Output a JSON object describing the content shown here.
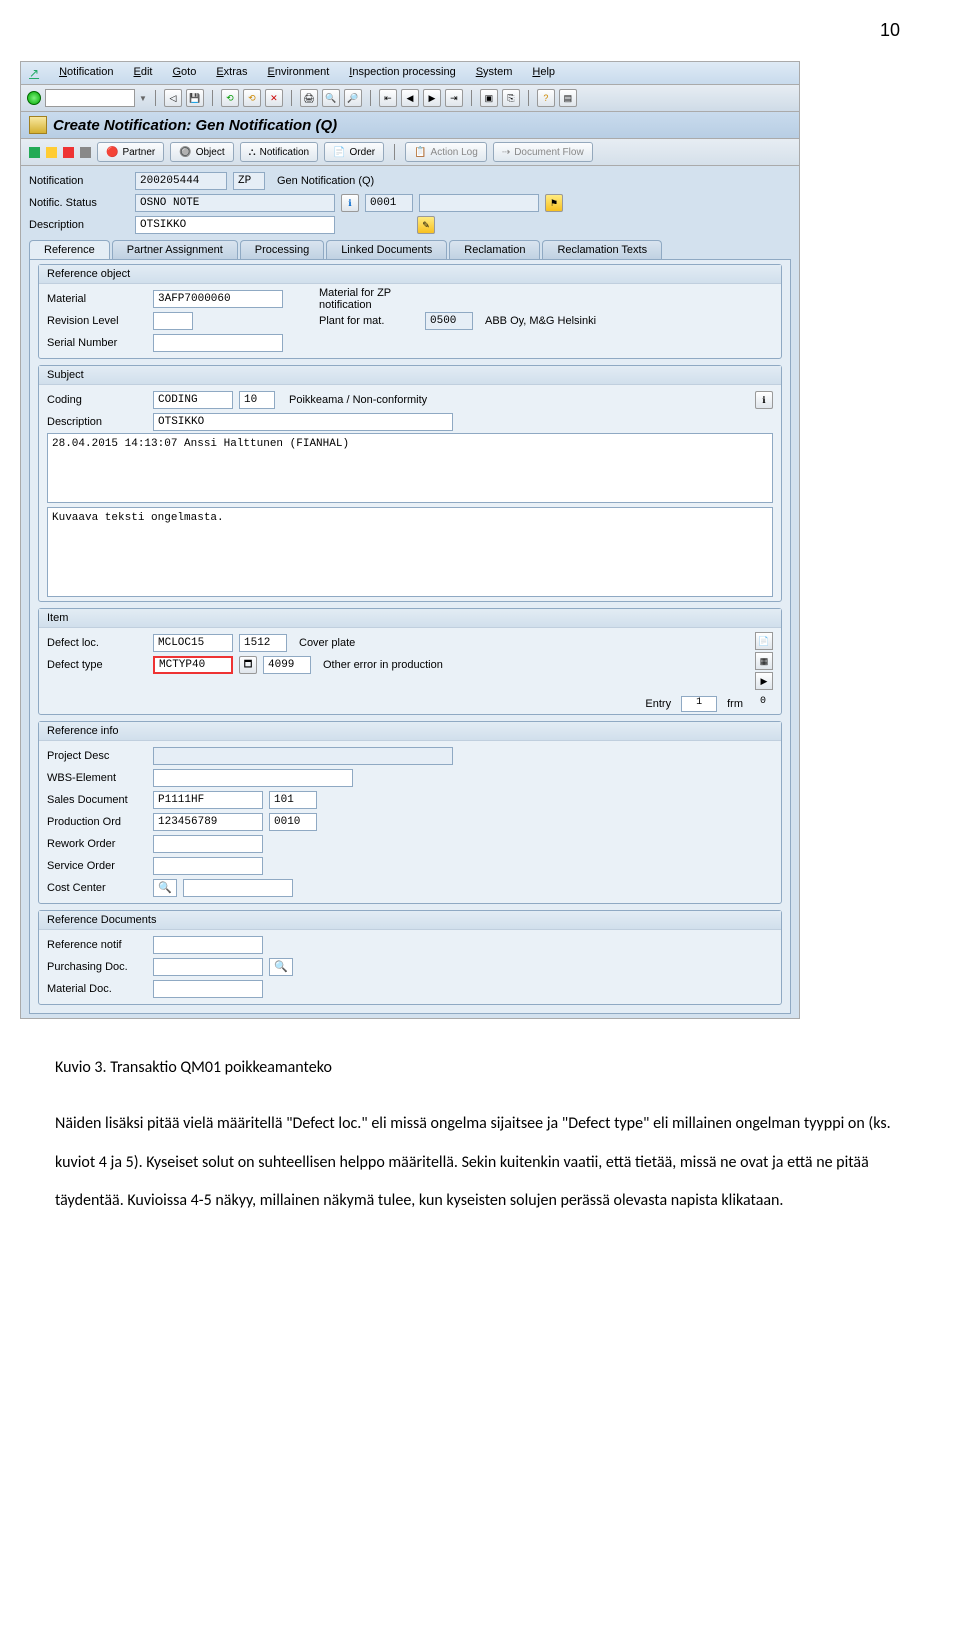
{
  "page_number": "10",
  "menu": [
    "Notification",
    "Edit",
    "Goto",
    "Extras",
    "Environment",
    "Inspection processing",
    "System",
    "Help"
  ],
  "title": "Create Notification: Gen Notification (Q)",
  "appbar": {
    "partner": "Partner",
    "object": "Object",
    "notification": "Notification",
    "order": "Order",
    "actionlog": "Action Log",
    "docflow": "Document Flow"
  },
  "header": {
    "notification_lbl": "Notification",
    "notification_val": "200205444",
    "notification_type": "ZP",
    "notification_desc": "Gen Notification (Q)",
    "status_lbl": "Notific. Status",
    "status_val": "OSNO NOTE",
    "status_code": "0001",
    "description_lbl": "Description",
    "description_val": "OTSIKKO"
  },
  "tabs": [
    "Reference",
    "Partner Assignment",
    "Processing",
    "Linked Documents",
    "Reclamation",
    "Reclamation Texts"
  ],
  "ref_object": {
    "title": "Reference object",
    "material_lbl": "Material",
    "material_val": "3AFP7000060",
    "material_desc": "Material for ZP notification",
    "rev_lbl": "Revision Level",
    "plant_lbl": "Plant for mat.",
    "plant_val": "0500",
    "plant_desc": "ABB Oy, M&G Helsinki",
    "serial_lbl": "Serial Number"
  },
  "subject": {
    "title": "Subject",
    "coding_lbl": "Coding",
    "coding_val": "CODING",
    "coding_num": "10",
    "coding_desc": "Poikkeama / Non-conformity",
    "desc_lbl": "Description",
    "desc_val": "OTSIKKO",
    "log_line": "28.04.2015 14:13:07 Anssi Halttunen (FIANHAL)",
    "text": "Kuvaava teksti ongelmasta."
  },
  "item": {
    "title": "Item",
    "loc_lbl": "Defect loc.",
    "loc_val": "MCLOC15",
    "loc_num": "1512",
    "loc_desc": "Cover plate",
    "type_lbl": "Defect type",
    "type_val": "MCTYP40",
    "type_num": "4099",
    "type_desc": "Other error in production",
    "entry_lbl": "Entry",
    "entry_val": "1",
    "entry_frm": "frm",
    "entry_total": "0"
  },
  "refinfo": {
    "title": "Reference info",
    "proj_lbl": "Project Desc",
    "wbs_lbl": "WBS-Element",
    "sales_lbl": "Sales Document",
    "sales_val": "P1111HF",
    "sales_item": "101",
    "prod_lbl": "Production Ord",
    "prod_val": "123456789",
    "prod_item": "0010",
    "rework_lbl": "Rework Order",
    "service_lbl": "Service Order",
    "cost_lbl": "Cost Center"
  },
  "refdocs": {
    "title": "Reference Documents",
    "refnotif_lbl": "Reference notif",
    "purch_lbl": "Purchasing Doc.",
    "mat_lbl": "Material Doc."
  },
  "caption": {
    "figure": "Kuvio 3. Transaktio QM01 poikkeamanteko",
    "body": "Näiden lisäksi pitää vielä määritellä \"Defect loc.\" eli missä ongelma sijaitsee ja \"Defect type\" eli millainen ongelman tyyppi on (ks. kuviot 4 ja 5). Kyseiset solut on suhteellisen helppo määritellä. Sekin kuitenkin vaatii, että tietää, missä ne ovat ja että ne pitää täydentää. Kuvioissa 4-5 näkyy, millainen näkymä tulee, kun kyseisten solujen perässä olevasta napista klikataan."
  }
}
